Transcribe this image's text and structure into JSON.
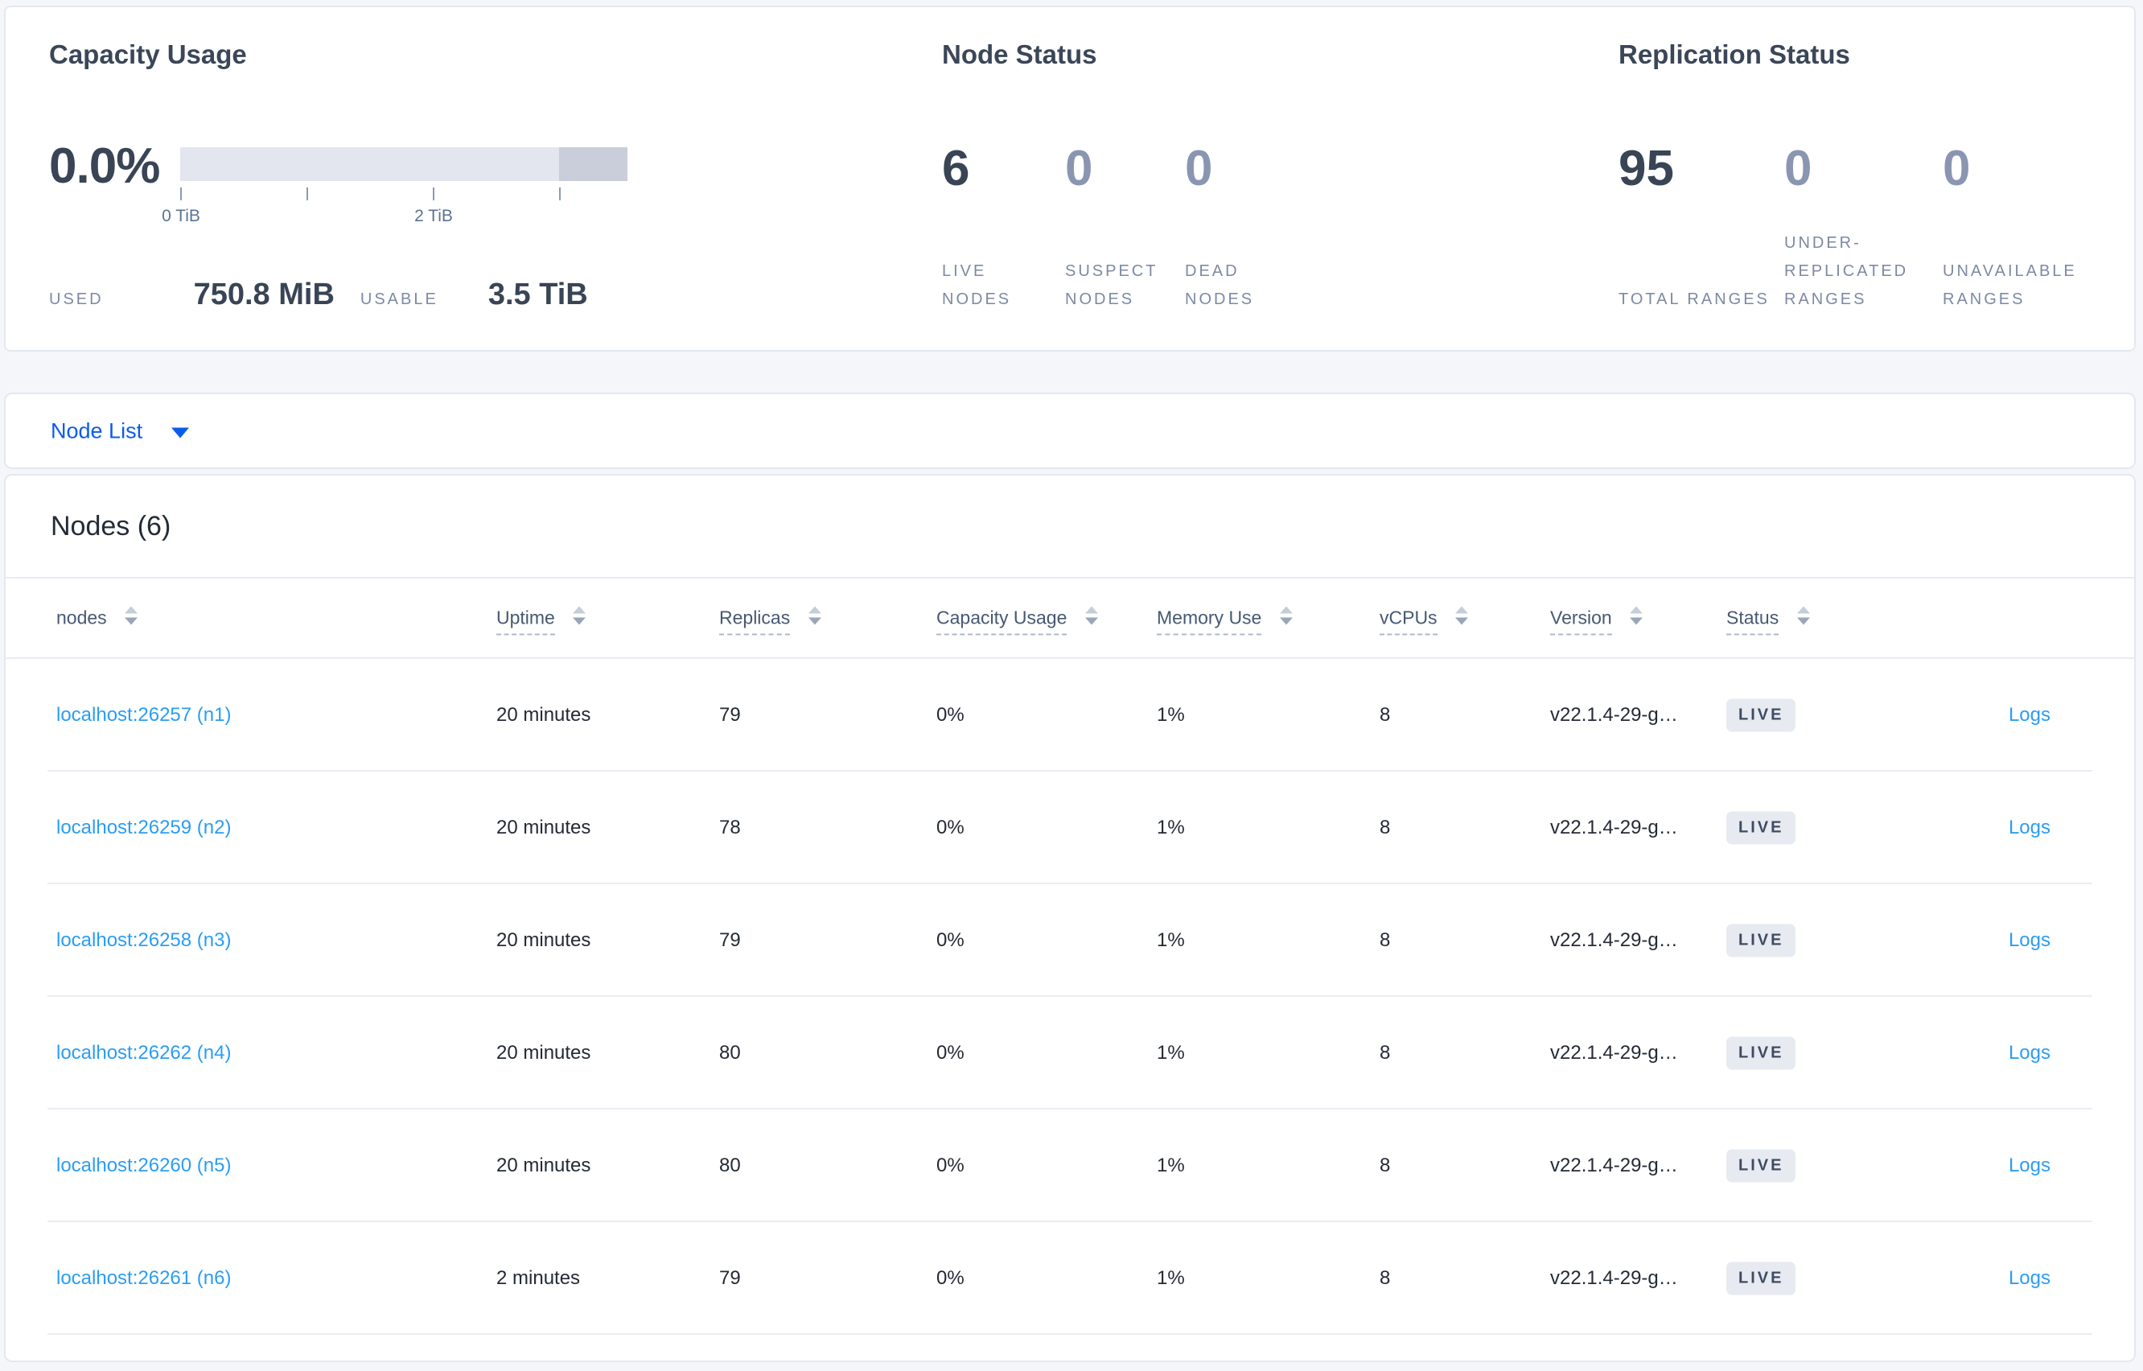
{
  "summary": {
    "capacity": {
      "title": "Capacity Usage",
      "percent": "0.0%",
      "tick_labels": [
        "0 TiB",
        "2 TiB"
      ],
      "bar": {
        "tick_positions_pct": [
          0,
          28.2,
          56.5,
          84.7
        ],
        "dark_segment_start_pct": 84.7
      },
      "used_label": "USED",
      "used_value": "750.8 MiB",
      "usable_label": "USABLE",
      "usable_value": "3.5 TiB"
    },
    "node_status": {
      "title": "Node Status",
      "stats": [
        {
          "value": "6",
          "label": "LIVE NODES"
        },
        {
          "value": "0",
          "label": "SUSPECT NODES"
        },
        {
          "value": "0",
          "label": "DEAD NODES"
        }
      ]
    },
    "replication_status": {
      "title": "Replication Status",
      "stats": [
        {
          "value": "95",
          "label": "TOTAL RANGES"
        },
        {
          "value": "0",
          "label": "UNDER-REPLICATED RANGES"
        },
        {
          "value": "0",
          "label": "UNAVAILABLE RANGES"
        }
      ]
    }
  },
  "node_list": {
    "label": "Node List"
  },
  "table": {
    "title": "Nodes (6)",
    "columns": [
      {
        "label": "nodes"
      },
      {
        "label": "Uptime"
      },
      {
        "label": "Replicas"
      },
      {
        "label": "Capacity Usage"
      },
      {
        "label": "Memory Use"
      },
      {
        "label": "vCPUs"
      },
      {
        "label": "Version"
      },
      {
        "label": "Status"
      }
    ],
    "rows": [
      {
        "address": "localhost:26257 (n1)",
        "uptime": "20 minutes",
        "replicas": "79",
        "capacity": "0%",
        "memory": "1%",
        "vcpus": "8",
        "version": "v22.1.4-29-g…",
        "status": "LIVE",
        "logs": "Logs"
      },
      {
        "address": "localhost:26259 (n2)",
        "uptime": "20 minutes",
        "replicas": "78",
        "capacity": "0%",
        "memory": "1%",
        "vcpus": "8",
        "version": "v22.1.4-29-g…",
        "status": "LIVE",
        "logs": "Logs"
      },
      {
        "address": "localhost:26258 (n3)",
        "uptime": "20 minutes",
        "replicas": "79",
        "capacity": "0%",
        "memory": "1%",
        "vcpus": "8",
        "version": "v22.1.4-29-g…",
        "status": "LIVE",
        "logs": "Logs"
      },
      {
        "address": "localhost:26262 (n4)",
        "uptime": "20 minutes",
        "replicas": "80",
        "capacity": "0%",
        "memory": "1%",
        "vcpus": "8",
        "version": "v22.1.4-29-g…",
        "status": "LIVE",
        "logs": "Logs"
      },
      {
        "address": "localhost:26260 (n5)",
        "uptime": "20 minutes",
        "replicas": "80",
        "capacity": "0%",
        "memory": "1%",
        "vcpus": "8",
        "version": "v22.1.4-29-g…",
        "status": "LIVE",
        "logs": "Logs"
      },
      {
        "address": "localhost:26261 (n6)",
        "uptime": "2 minutes",
        "replicas": "79",
        "capacity": "0%",
        "memory": "1%",
        "vcpus": "8",
        "version": "v22.1.4-29-g…",
        "status": "LIVE",
        "logs": "Logs"
      }
    ]
  },
  "colors": {
    "page_bg": "#f4f6fa",
    "accent_blue": "#0b5cec",
    "link_blue": "#2b9df3",
    "heading_slate": "#394455",
    "muted_slate": "#7d89a3",
    "muted_stat": "#8a96b1",
    "badge_bg": "#e7eaf1",
    "bar_light": "#e3e6ef",
    "bar_dark": "#c9ceda"
  }
}
